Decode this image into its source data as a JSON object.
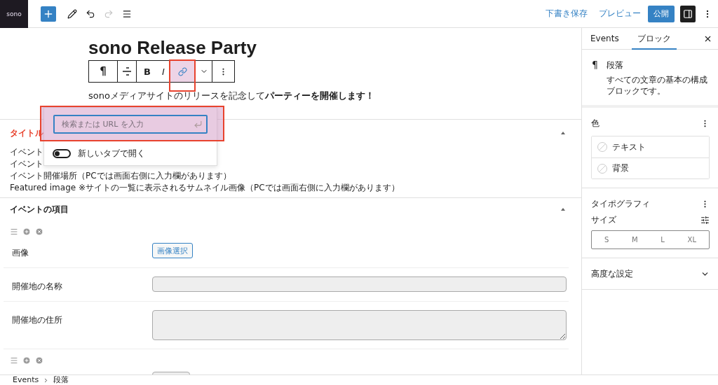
{
  "topbar": {
    "logo": "sono",
    "tools": [
      {
        "kind": "add",
        "disabled": false
      },
      {
        "kind": "edit",
        "disabled": false
      },
      {
        "kind": "undo",
        "disabled": false
      },
      {
        "kind": "redo",
        "disabled": true
      },
      {
        "kind": "list",
        "disabled": false
      }
    ],
    "save_draft": "下書き保存",
    "preview": "プレビュー",
    "publish": "公開",
    "settings_pressed": true
  },
  "post": {
    "title": "sono Release Party",
    "paragraph": "sonoメディアサイトのリリースを記念して**パーティーを開催します！**"
  },
  "block_toolbar": [
    {
      "kind": "paragraph",
      "label": "¶",
      "highlighted": false
    },
    {
      "kind": "align",
      "highlighted": false
    },
    {
      "kind": "bold",
      "label": "B",
      "highlighted": false
    },
    {
      "kind": "italic",
      "label": "I",
      "highlighted": false
    },
    {
      "kind": "link",
      "highlighted": true
    },
    {
      "kind": "more",
      "highlighted": false
    },
    {
      "kind": "options",
      "highlighted": false
    }
  ],
  "link_popover": {
    "placeholder": "検索または URL を入力",
    "highlighted": true,
    "new_tab_label": "新しいタブで開く",
    "new_tab_on": false
  },
  "meta_boxes": [
    {
      "title": "タイトル",
      "alert": true,
      "expanded": true,
      "lines": [
        "イベント",
        "イベント",
        "イベント開催場所（PCでは画面右側に入力欄があります）",
        "Featured image ※サイトの一覧に表示されるサムネイル画像（PCでは画面右側に入力欄があります）"
      ]
    },
    {
      "title": "イベントの項目",
      "alert": false,
      "expanded": true,
      "groups": [
        {
          "fields": [
            {
              "kind": "image",
              "label": "画像",
              "button": "画像選択"
            },
            {
              "kind": "text",
              "label": "開催地の名称"
            },
            {
              "kind": "textarea",
              "label": "開催地の住所"
            }
          ]
        },
        {
          "fields": [
            {
              "kind": "short"
            }
          ]
        }
      ]
    }
  ],
  "sidebar": {
    "tabs": [
      {
        "label": "Events",
        "selected": false
      },
      {
        "label": "ブロック",
        "selected": true
      }
    ],
    "block": {
      "icon": "¶",
      "name": "段落",
      "description": "すべての文章の基本の構成ブロックです。"
    },
    "color": {
      "title": "色",
      "items": [
        "テキスト",
        "背景"
      ]
    },
    "typography": {
      "title": "タイポグラフィ",
      "size_label": "サイズ",
      "sizes": [
        {
          "label": "S",
          "selected": false
        },
        {
          "label": "M",
          "selected": false
        },
        {
          "label": "L",
          "selected": false
        },
        {
          "label": "XL",
          "selected": false
        }
      ]
    },
    "advanced": {
      "title": "高度な設定",
      "expanded": false
    }
  },
  "breadcrumb": [
    "Events",
    "段落"
  ]
}
